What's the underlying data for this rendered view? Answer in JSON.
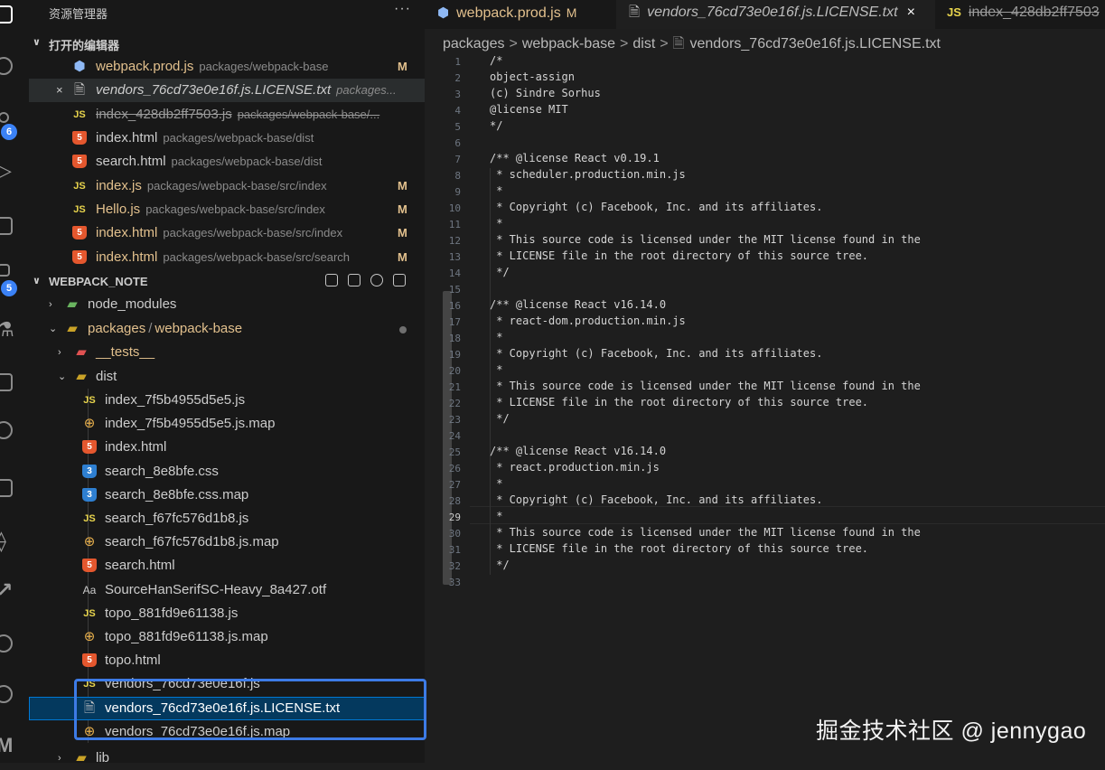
{
  "explorer": {
    "header": "资源管理器",
    "more": "···",
    "open_editors": {
      "title": "打开的编辑器",
      "items": [
        {
          "name": "webpack.prod.js",
          "desc": "packages/webpack-base",
          "status": "M",
          "icon": "hexagon-icon"
        },
        {
          "name": "vendors_76cd73e0e16f.js.LICENSE.txt",
          "desc": "packages...",
          "status": "",
          "icon": "text-file-icon",
          "close": "×"
        },
        {
          "name": "index_428db2ff7503.js",
          "desc": "packages/webpack-base/...",
          "status": "",
          "icon": "js-file-icon"
        },
        {
          "name": "index.html",
          "desc": "packages/webpack-base/dist",
          "status": "",
          "icon": "html-file-icon"
        },
        {
          "name": "search.html",
          "desc": "packages/webpack-base/dist",
          "status": "",
          "icon": "html-file-icon"
        },
        {
          "name": "index.js",
          "desc": "packages/webpack-base/src/index",
          "status": "M",
          "icon": "js-file-icon"
        },
        {
          "name": "Hello.js",
          "desc": "packages/webpack-base/src/index",
          "status": "M",
          "icon": "js-file-icon"
        },
        {
          "name": "index.html",
          "desc": "packages/webpack-base/src/index",
          "status": "M",
          "icon": "html-file-icon"
        },
        {
          "name": "index.html",
          "desc": "packages/webpack-base/src/search",
          "status": "M",
          "icon": "html-file-icon"
        }
      ]
    },
    "workspace": {
      "title": "WEBPACK_NOTE",
      "tree": {
        "node_modules": "node_modules",
        "packages": "packages",
        "packages_sep": "/",
        "webpack_base": "webpack-base",
        "tests": "__tests__",
        "dist": "dist",
        "lib": "lib",
        "files": [
          {
            "name": "index_7f5b4955d5e5.js",
            "type": "js"
          },
          {
            "name": "index_7f5b4955d5e5.js.map",
            "type": "map"
          },
          {
            "name": "index.html",
            "type": "html"
          },
          {
            "name": "search_8e8bfe.css",
            "type": "css"
          },
          {
            "name": "search_8e8bfe.css.map",
            "type": "cssmap"
          },
          {
            "name": "search_f67fc576d1b8.js",
            "type": "js"
          },
          {
            "name": "search_f67fc576d1b8.js.map",
            "type": "map"
          },
          {
            "name": "search.html",
            "type": "html"
          },
          {
            "name": "SourceHanSerifSC-Heavy_8a427.otf",
            "type": "font"
          },
          {
            "name": "topo_881fd9e61138.js",
            "type": "js"
          },
          {
            "name": "topo_881fd9e61138.js.map",
            "type": "map"
          },
          {
            "name": "topo.html",
            "type": "html"
          },
          {
            "name": "vendors_76cd73e0e16f.js",
            "type": "js"
          },
          {
            "name": "vendors_76cd73e0e16f.js.LICENSE.txt",
            "type": "txt"
          },
          {
            "name": "vendors_76cd73e0e16f.js.map",
            "type": "map"
          }
        ]
      }
    }
  },
  "activity_badges": {
    "source_control": "6",
    "extensions": "5"
  },
  "tabs": [
    {
      "label": "webpack.prod.js",
      "badge": "M",
      "icon": "hexagon-icon"
    },
    {
      "label": "vendors_76cd73e0e16f.js.LICENSE.txt",
      "close": "×",
      "icon": "text-file-icon"
    },
    {
      "label": "index_428db2ff7503",
      "icon": "js-file-icon"
    }
  ],
  "icon_labels": {
    "js": "JS",
    "html": "5",
    "css": "3",
    "font": "Aa"
  },
  "breadcrumb": [
    "packages",
    "webpack-base",
    "dist",
    "vendors_76cd73e0e16f.js.LICENSE.txt"
  ],
  "breadcrumb_sep": ">",
  "editor": {
    "current_line": 29,
    "lines": [
      "/*",
      "object-assign",
      "(c) Sindre Sorhus",
      "@license MIT",
      "*/",
      "",
      "/** @license React v0.19.1",
      " * scheduler.production.min.js",
      " *",
      " * Copyright (c) Facebook, Inc. and its affiliates.",
      " *",
      " * This source code is licensed under the MIT license found in the",
      " * LICENSE file in the root directory of this source tree.",
      " */",
      "",
      "/** @license React v16.14.0",
      " * react-dom.production.min.js",
      " *",
      " * Copyright (c) Facebook, Inc. and its affiliates.",
      " *",
      " * This source code is licensed under the MIT license found in the",
      " * LICENSE file in the root directory of this source tree.",
      " */",
      "",
      "/** @license React v16.14.0",
      " * react.production.min.js",
      " *",
      " * Copyright (c) Facebook, Inc. and its affiliates.",
      " *",
      " * This source code is licensed under the MIT license found in the",
      " * LICENSE file in the root directory of this source tree.",
      " */",
      ""
    ]
  },
  "watermark": "掘金技术社区 @ jennygao",
  "colors": {
    "accent": "#3d7be6",
    "modified": "#e2c08d",
    "badge": "#3b82f6"
  }
}
